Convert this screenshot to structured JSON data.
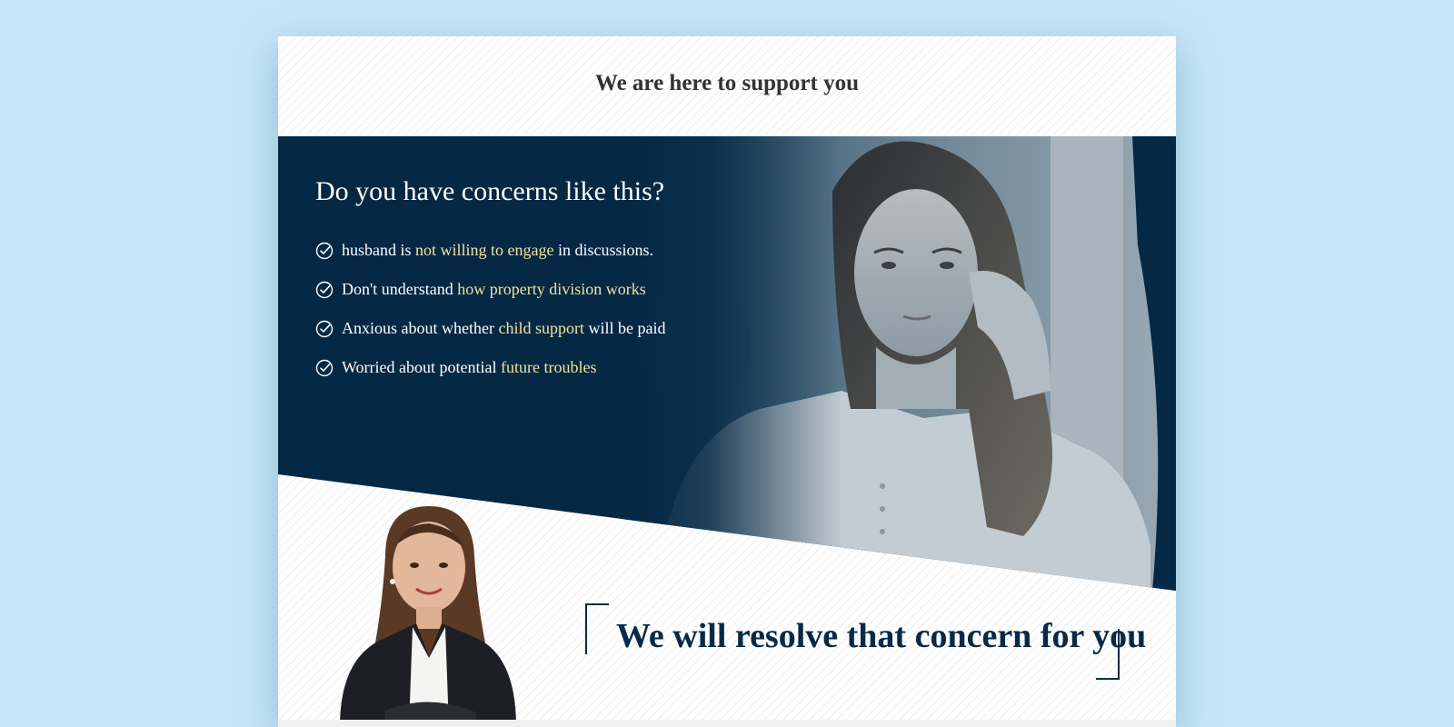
{
  "header": {
    "title": "We are here to support you"
  },
  "hero": {
    "heading": "Do you have concerns like this?",
    "items": [
      {
        "before": "husband is ",
        "highlight": "not willing to engage",
        "after": " in discussions."
      },
      {
        "before": "Don't understand ",
        "highlight": "how property division works",
        "after": ""
      },
      {
        "before": "Anxious about whether ",
        "highlight": "child support",
        "after": " will be paid"
      },
      {
        "before": "Worried about potential ",
        "highlight": "future troubles",
        "after": ""
      }
    ]
  },
  "resolve": {
    "heading": "We will resolve that concern for you"
  },
  "colors": {
    "page_background": "#c5e6f8",
    "navy": "#052845",
    "highlight": "#f3e39c",
    "heading_text": "#062a47"
  },
  "icons": {
    "list_marker": "check-circle-icon"
  }
}
